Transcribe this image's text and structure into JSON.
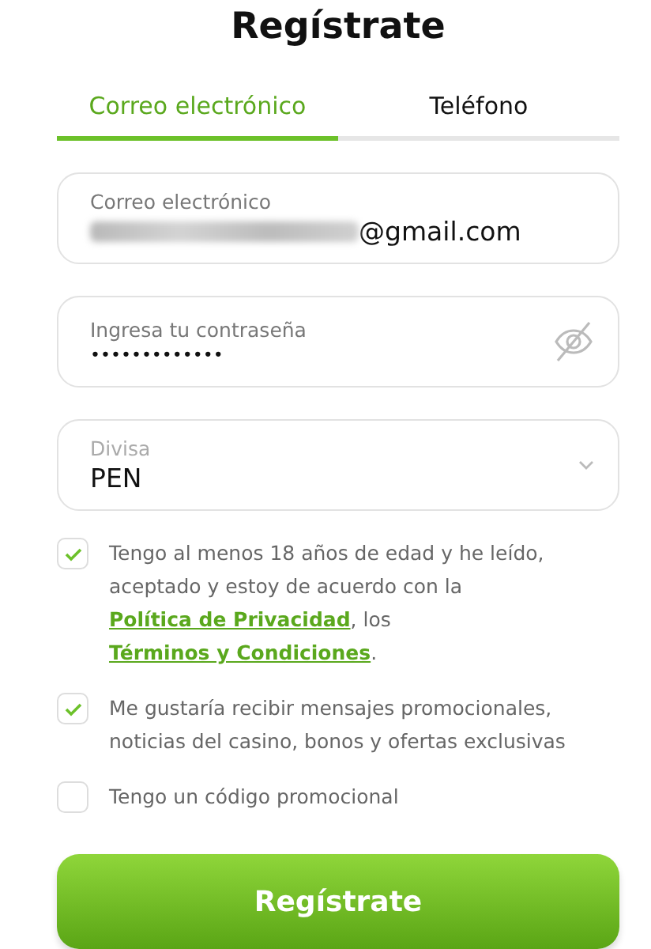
{
  "title": "Regístrate",
  "tabs": [
    {
      "label": "Correo electrónico",
      "selected": true
    },
    {
      "label": "Teléfono",
      "selected": false
    }
  ],
  "fields": [
    {
      "kind": "email",
      "label": "Correo electrónico",
      "value": "@gmail.com",
      "redacted": true
    },
    {
      "kind": "password",
      "label": "Ingresa tu contraseña",
      "value": "•••••••••••••"
    },
    {
      "kind": "select",
      "label": "Divisa",
      "value": "PEN"
    }
  ],
  "checkboxes": [
    {
      "checked": true,
      "parts": [
        {
          "kind": "text",
          "text": "Tengo al menos 18 años de edad y he leído, aceptado y estoy de acuerdo con la "
        },
        {
          "kind": "link",
          "text": "Política de Privacidad"
        },
        {
          "kind": "text",
          "text": ", los "
        },
        {
          "kind": "link",
          "text": "Términos y Condiciones"
        },
        {
          "kind": "text",
          "text": "."
        }
      ]
    },
    {
      "checked": true,
      "parts": [
        {
          "kind": "text",
          "text": "Me gustaría recibir mensajes promocionales, noticias del casino, bonos y ofertas exclusivas"
        }
      ]
    },
    {
      "checked": false,
      "parts": [
        {
          "kind": "text",
          "text": "Tengo un código promocional"
        }
      ]
    }
  ],
  "submit": "Regístrate"
}
